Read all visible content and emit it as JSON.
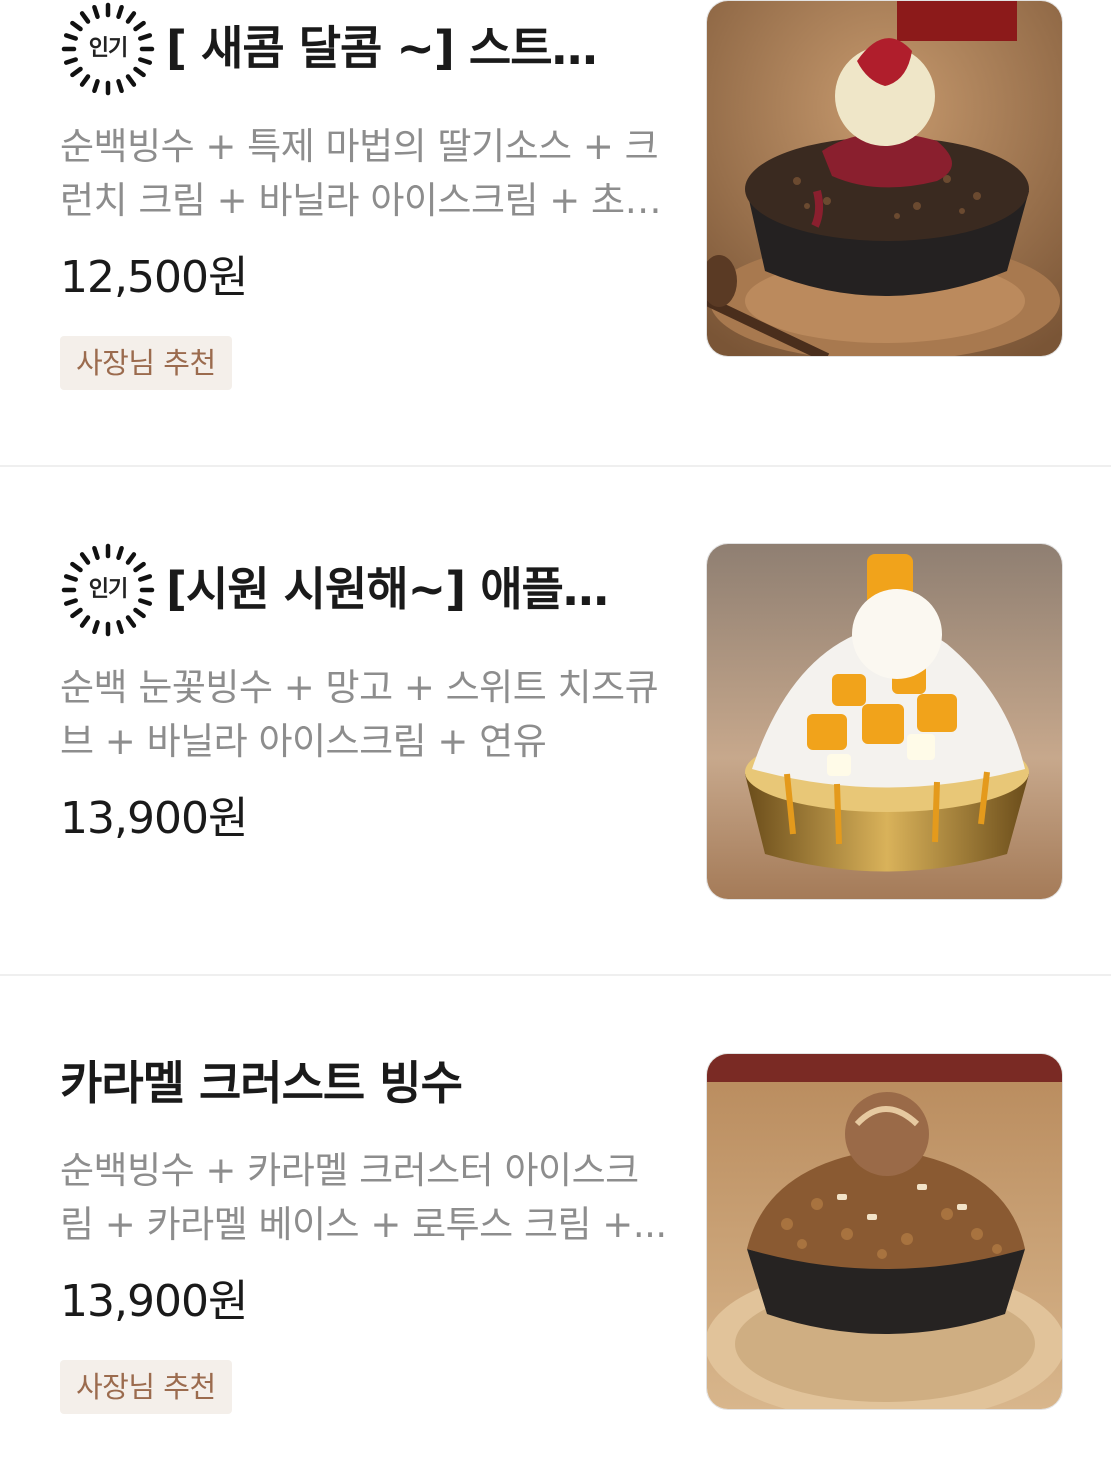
{
  "menu": {
    "items": [
      {
        "badge": "인기",
        "title": "[ 새콤 달콤 ~] 스트…",
        "description": "순백빙수 + 특제 마법의 딸기소스 + 크런치 크림 + 바닐라 아이스크림 + 초…",
        "price": "12,500원",
        "tag": "사장님 추천",
        "image_icon": "strawberry-bingsu-photo"
      },
      {
        "badge": "인기",
        "title": "[시원 시원해~] 애플…",
        "description": "순백 눈꽃빙수 + 망고 + 스위트 치즈큐브 + 바닐라 아이스크림 +  연유",
        "price": "13,900원",
        "image_icon": "mango-bingsu-photo"
      },
      {
        "title": "카라멜 크러스트 빙수",
        "description": "순백빙수 + 카라멜 크러스터 아이스크림 + 카라멜 베이스 + 로투스 크림 +...",
        "price": "13,900원",
        "tag": "사장님 추천",
        "image_icon": "caramel-bingsu-photo"
      }
    ]
  },
  "colors": {
    "title": "#1a1a1a",
    "description": "#8d8d8d",
    "tag_background": "#f4efea",
    "tag_text": "#9b6b4e",
    "divider": "#efefef"
  }
}
